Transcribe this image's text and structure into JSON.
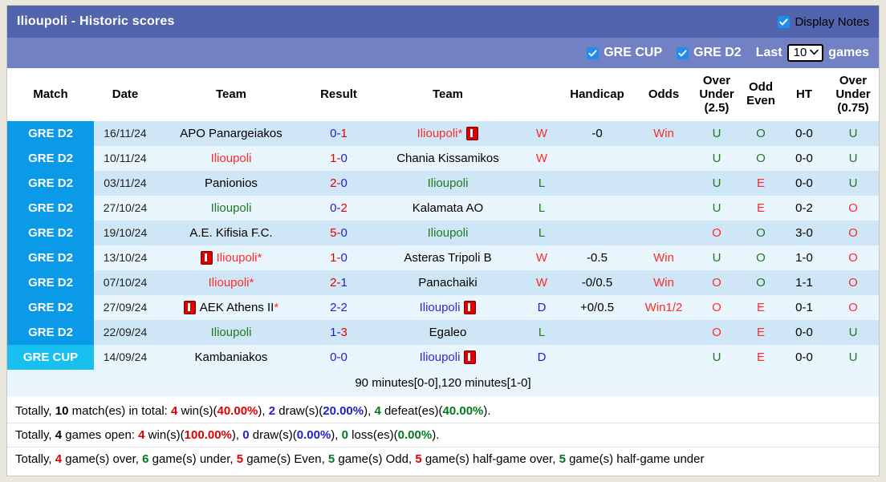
{
  "header": {
    "title": "Ilioupoli - Historic scores",
    "display_notes_label": "Display Notes",
    "display_notes_checked": true,
    "gre_cup_label": "GRE CUP",
    "gre_cup_checked": true,
    "gre_d2_label": "GRE D2",
    "gre_d2_checked": true,
    "last_label": "Last",
    "games_count": "10",
    "games_label": "games",
    "chevron": "⌄"
  },
  "columns": [
    "Match",
    "Date",
    "Team",
    "Result",
    "Team",
    "",
    "Handicap",
    "Odds",
    "Over Under (2.5)",
    "Odd Even",
    "HT",
    "Over Under (0.75)"
  ],
  "column_lines": {
    "match": "Match",
    "date": "Date",
    "team_home": "Team",
    "result": "Result",
    "team_away": "Team",
    "wdl": "",
    "handicap": "Handicap",
    "odds": "Odds",
    "ou25_l1": "Over",
    "ou25_l2": "Under",
    "ou25_l3": "(2.5)",
    "oddeven_l1": "Odd",
    "oddeven_l2": "Even",
    "ht": "HT",
    "ou075_l1": "Over",
    "ou075_l2": "Under",
    "ou075_l3": "(0.75)"
  },
  "rows": [
    {
      "league": "GRE D2",
      "league_type": "d2",
      "date": "16/11/24",
      "home": "APO Panargeiakos",
      "home_color": "black",
      "home_star": false,
      "home_card_before": false,
      "home_card_after": false,
      "score_a": "0",
      "score_b": "1",
      "score_a_color": "blue",
      "score_b_color": "red",
      "away": "Ilioupoli",
      "away_color": "red",
      "away_star": true,
      "away_card_before": false,
      "away_card_after": true,
      "wdl": "W",
      "wdl_type": "w",
      "handicap": "-0",
      "odds": "Win",
      "ou25": "U",
      "ou25_type": "u",
      "oddeven": "O",
      "oddeven_type": "o",
      "ht": "0-0",
      "ou075": "U",
      "ou075_type": "u"
    },
    {
      "league": "GRE D2",
      "league_type": "d2",
      "date": "10/11/24",
      "home": "Ilioupoli",
      "home_color": "red",
      "home_star": false,
      "home_card_before": false,
      "home_card_after": false,
      "score_a": "1",
      "score_b": "0",
      "score_a_color": "red",
      "score_b_color": "blue",
      "away": "Chania Kissamikos",
      "away_color": "black",
      "away_star": false,
      "away_card_before": false,
      "away_card_after": false,
      "wdl": "W",
      "wdl_type": "w",
      "handicap": "",
      "odds": "",
      "ou25": "U",
      "ou25_type": "u",
      "oddeven": "O",
      "oddeven_type": "o",
      "ht": "0-0",
      "ou075": "U",
      "ou075_type": "u"
    },
    {
      "league": "GRE D2",
      "league_type": "d2",
      "date": "03/11/24",
      "home": "Panionios",
      "home_color": "black",
      "home_star": false,
      "home_card_before": false,
      "home_card_after": false,
      "score_a": "2",
      "score_b": "0",
      "score_a_color": "red",
      "score_b_color": "blue",
      "away": "Ilioupoli",
      "away_color": "green",
      "away_star": false,
      "away_card_before": false,
      "away_card_after": false,
      "wdl": "L",
      "wdl_type": "l",
      "handicap": "",
      "odds": "",
      "ou25": "U",
      "ou25_type": "u",
      "oddeven": "E",
      "oddeven_type": "e",
      "ht": "0-0",
      "ou075": "U",
      "ou075_type": "u"
    },
    {
      "league": "GRE D2",
      "league_type": "d2",
      "date": "27/10/24",
      "home": "Ilioupoli",
      "home_color": "green",
      "home_star": false,
      "home_card_before": false,
      "home_card_after": false,
      "score_a": "0",
      "score_b": "2",
      "score_a_color": "blue",
      "score_b_color": "red",
      "away": "Kalamata AO",
      "away_color": "black",
      "away_star": false,
      "away_card_before": false,
      "away_card_after": false,
      "wdl": "L",
      "wdl_type": "l",
      "handicap": "",
      "odds": "",
      "ou25": "U",
      "ou25_type": "u",
      "oddeven": "E",
      "oddeven_type": "e",
      "ht": "0-2",
      "ou075": "O",
      "ou075_type": "o"
    },
    {
      "league": "GRE D2",
      "league_type": "d2",
      "date": "19/10/24",
      "home": "A.E. Kifisia F.C.",
      "home_color": "black",
      "home_star": false,
      "home_card_before": false,
      "home_card_after": false,
      "score_a": "5",
      "score_b": "0",
      "score_a_color": "red",
      "score_b_color": "blue",
      "away": "Ilioupoli",
      "away_color": "green",
      "away_star": false,
      "away_card_before": false,
      "away_card_after": false,
      "wdl": "L",
      "wdl_type": "l",
      "handicap": "",
      "odds": "",
      "ou25": "O",
      "ou25_type": "o",
      "oddeven": "O",
      "oddeven_type": "o",
      "ht": "3-0",
      "ou075": "O",
      "ou075_type": "o"
    },
    {
      "league": "GRE D2",
      "league_type": "d2",
      "date": "13/10/24",
      "home": "Ilioupoli",
      "home_color": "red",
      "home_star": true,
      "home_card_before": true,
      "home_card_after": false,
      "score_a": "1",
      "score_b": "0",
      "score_a_color": "red",
      "score_b_color": "blue",
      "away": "Asteras Tripoli B",
      "away_color": "black",
      "away_star": false,
      "away_card_before": false,
      "away_card_after": false,
      "wdl": "W",
      "wdl_type": "w",
      "handicap": "-0.5",
      "odds": "Win",
      "ou25": "U",
      "ou25_type": "u",
      "oddeven": "O",
      "oddeven_type": "o",
      "ht": "1-0",
      "ou075": "O",
      "ou075_type": "o"
    },
    {
      "league": "GRE D2",
      "league_type": "d2",
      "date": "07/10/24",
      "home": "Ilioupoli",
      "home_color": "red",
      "home_star": true,
      "home_card_before": false,
      "home_card_after": false,
      "score_a": "2",
      "score_b": "1",
      "score_a_color": "red",
      "score_b_color": "blue",
      "away": "Panachaiki",
      "away_color": "black",
      "away_star": false,
      "away_card_before": false,
      "away_card_after": false,
      "wdl": "W",
      "wdl_type": "w",
      "handicap": "-0/0.5",
      "odds": "Win",
      "ou25": "O",
      "ou25_type": "o",
      "oddeven": "O",
      "oddeven_type": "o",
      "ht": "1-1",
      "ou075": "O",
      "ou075_type": "o"
    },
    {
      "league": "GRE D2",
      "league_type": "d2",
      "date": "27/09/24",
      "home": "AEK Athens II",
      "home_color": "black",
      "home_star": true,
      "home_card_before": true,
      "home_card_after": false,
      "score_a": "2",
      "score_b": "2",
      "score_a_color": "blue",
      "score_b_color": "blue",
      "away": "Ilioupoli",
      "away_color": "blue",
      "away_star": false,
      "away_card_before": false,
      "away_card_after": true,
      "wdl": "D",
      "wdl_type": "d",
      "handicap": "+0/0.5",
      "odds": "Win1/2",
      "ou25": "O",
      "ou25_type": "o",
      "oddeven": "E",
      "oddeven_type": "e",
      "ht": "0-1",
      "ou075": "O",
      "ou075_type": "o"
    },
    {
      "league": "GRE D2",
      "league_type": "d2",
      "date": "22/09/24",
      "home": "Ilioupoli",
      "home_color": "green",
      "home_star": false,
      "home_card_before": false,
      "home_card_after": false,
      "score_a": "1",
      "score_b": "3",
      "score_a_color": "blue",
      "score_b_color": "red",
      "away": "Egaleo",
      "away_color": "black",
      "away_star": false,
      "away_card_before": false,
      "away_card_after": false,
      "wdl": "L",
      "wdl_type": "l",
      "handicap": "",
      "odds": "",
      "ou25": "O",
      "ou25_type": "o",
      "oddeven": "E",
      "oddeven_type": "e",
      "ht": "0-0",
      "ou075": "U",
      "ou075_type": "u"
    },
    {
      "league": "GRE CUP",
      "league_type": "cup",
      "date": "14/09/24",
      "home": "Kambaniakos",
      "home_color": "black",
      "home_star": false,
      "home_card_before": false,
      "home_card_after": false,
      "score_a": "0",
      "score_b": "0",
      "score_a_color": "blue",
      "score_b_color": "blue",
      "away": "Ilioupoli",
      "away_color": "blue",
      "away_star": false,
      "away_card_before": false,
      "away_card_after": true,
      "wdl": "D",
      "wdl_type": "d",
      "handicap": "",
      "odds": "",
      "ou25": "U",
      "ou25_type": "u",
      "oddeven": "E",
      "oddeven_type": "e",
      "ht": "0-0",
      "ou075": "U",
      "ou075_type": "u"
    }
  ],
  "note_row": "90 minutes[0-0],120 minutes[1-0]",
  "footer": {
    "line1": {
      "p1": "Totally, ",
      "total": "10",
      "p2": " match(es) in total: ",
      "wins": "4",
      "p3": " win(s)(",
      "win_pct": "40.00%",
      "p4": "), ",
      "draws": "2",
      "p5": " draw(s)(",
      "draw_pct": "20.00%",
      "p6": "), ",
      "defeats": "4",
      "p7": " defeat(es)(",
      "defeat_pct": "40.00%",
      "p8": ")."
    },
    "line2": {
      "p1": "Totally, ",
      "open": "4",
      "p2": " games open: ",
      "wins": "4",
      "p3": " win(s)(",
      "win_pct": "100.00%",
      "p4": "), ",
      "draws": "0",
      "p5": " draw(s)(",
      "draw_pct": "0.00%",
      "p6": "), ",
      "losses": "0",
      "p7": " loss(es)(",
      "loss_pct": "0.00%",
      "p8": ")."
    },
    "line3": {
      "p1": "Totally, ",
      "over": "4",
      "p2": " game(s) over, ",
      "under": "6",
      "p3": " game(s) under, ",
      "even": "5",
      "p4": " game(s) Even, ",
      "odd": "5",
      "p5": " game(s) Odd, ",
      "half_over": "5",
      "p6": " game(s) half-game over, ",
      "half_under": "5",
      "p7": " game(s) half-game under"
    }
  },
  "colors": {
    "title_bar": "#5264ad",
    "option_bar": "#7280c4",
    "badge_d2": "#0b9ae8",
    "badge_cup": "#17c0ee",
    "row_odd": "#cfe6f6",
    "row_even": "#e9f5fc",
    "red": "#ff2a2a",
    "green": "#1f7a1f",
    "blue": "#2020cf"
  }
}
